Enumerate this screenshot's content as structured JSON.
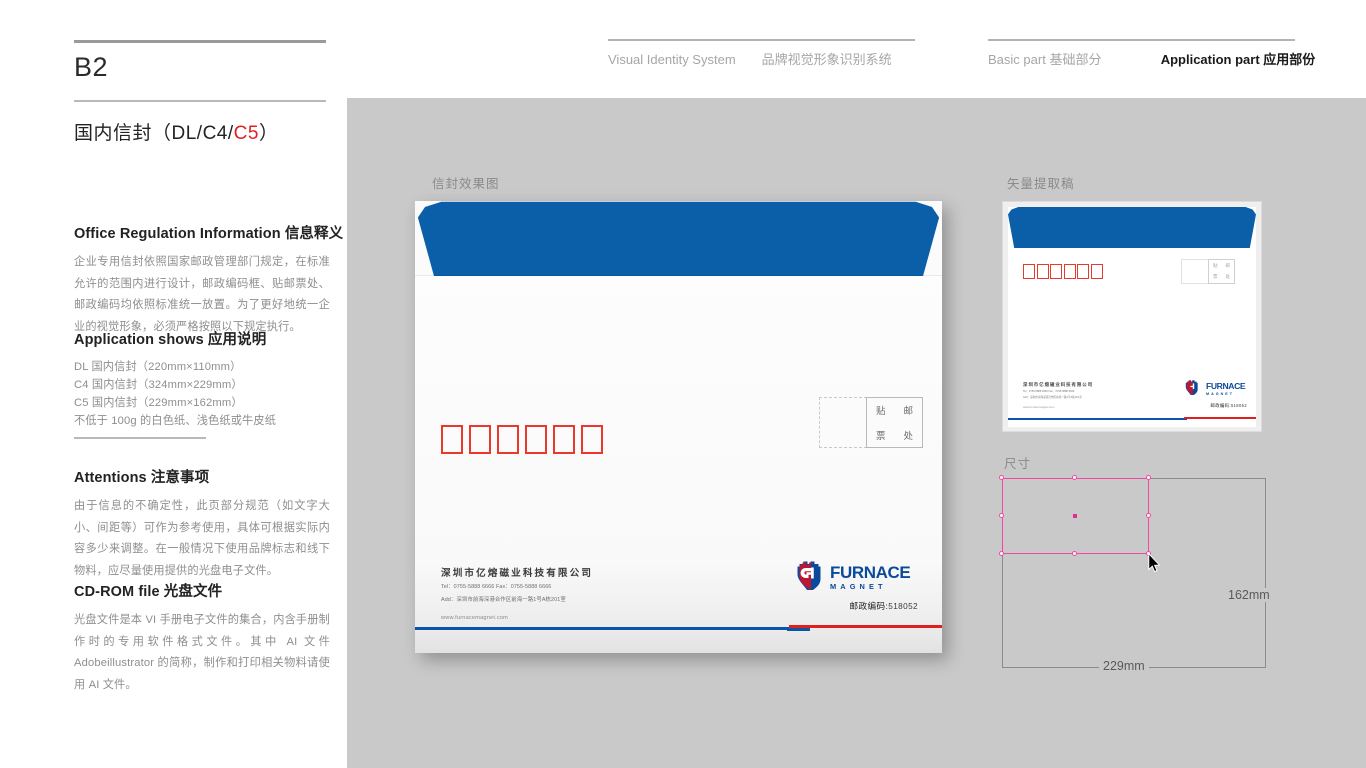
{
  "left": {
    "page_code": "B2",
    "section_title_prefix": "国内信封（DL/C4/",
    "section_title_accent": "C5",
    "section_title_suffix": "）",
    "blocks": [
      {
        "heading": "Office Regulation Information 信息释义",
        "body": "企业专用信封依照国家邮政管理部门规定，在标准允许的范围内进行设计，邮政编码框、贴邮票处、邮政编码均依照标准统一放置。为了更好地统一企业的视觉形象，必须严格按照以下规定执行。"
      },
      {
        "heading": "Application shows 应用说明",
        "lines": [
          "DL 国内信封（220mm×110mm）",
          "C4 国内信封（324mm×229mm）",
          "C5 国内信封（229mm×162mm）",
          "不低于 100g 的白色纸、浅色纸或牛皮纸"
        ]
      },
      {
        "heading": "Attentions 注意事项",
        "body": "由于信息的不确定性，此页部分规范（如文字大小、间距等）可作为参考使用，具体可根据实际内容多少来调整。在一般情况下使用品牌标志和线下物料，应尽量使用提供的光盘电子文件。"
      },
      {
        "heading": "CD-ROM file 光盘文件",
        "body": "光盘文件是本 VI 手册电子文件的集合，内含手册制作时的专用软件格式文件。其中 AI 文件 Adobeillustrator 的简称，制作和打印相关物料请使用 AI 文件。"
      }
    ]
  },
  "header": {
    "system_en": "Visual Identity System",
    "system_cn": "品牌视觉形象识别系统",
    "basic_en": "Basic part",
    "basic_cn": "基础部分",
    "application_en": "Application part",
    "application_cn": "应用部份"
  },
  "canvas": {
    "label_mockup": "信封效果图",
    "label_vector": "矢量提取稿",
    "label_size": "尺寸"
  },
  "envelope": {
    "postcode_boxes": 6,
    "stamp_box": [
      "贴",
      "邮",
      "票",
      "处"
    ],
    "company_name": "深圳市亿熔磁业科技有限公司",
    "contact_line_1": "Tel：0755-5888 6666    Fax：0755-5888 6666",
    "contact_line_2": "Add：深圳市前海深港合作区前海一路1号A栋201室",
    "website": "www.furnacemagnet.com",
    "logo_word_main": "FURNACE",
    "logo_word_sub": "MAGNET",
    "zip_label": "邮政编码:",
    "zip_value": "518052"
  },
  "size_diagram": {
    "width_label": "229mm",
    "height_label": "162mm"
  },
  "colors": {
    "brand_blue": "#0b5ea8",
    "brand_red": "#e02020",
    "canvas_gray": "#c9c9c9",
    "selection_pink": "#ef4aa0"
  }
}
